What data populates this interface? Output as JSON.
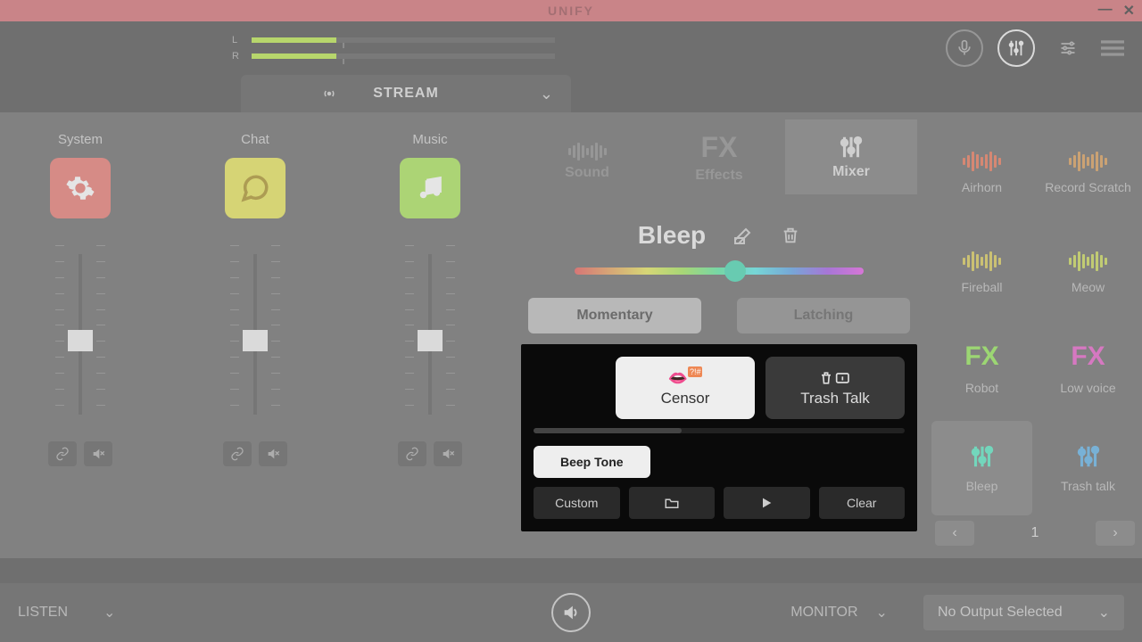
{
  "app": {
    "title": "UNIFY"
  },
  "meters": {
    "left_label": "L",
    "right_label": "R"
  },
  "stream_tab": {
    "label": "STREAM"
  },
  "header_icons": {
    "mic": "mic-icon",
    "mixer": "mixer-icon",
    "settings": "settings-icon"
  },
  "channels": [
    {
      "label": "System",
      "icon": "gear-icon",
      "color": "system"
    },
    {
      "label": "Chat",
      "icon": "chat-icon",
      "color": "chat"
    },
    {
      "label": "Music",
      "icon": "music-icon",
      "color": "music"
    }
  ],
  "tabs": [
    {
      "label": "Sound",
      "icon": "sound-icon"
    },
    {
      "label": "Effects",
      "icon": "fx-icon"
    },
    {
      "label": "Mixer",
      "icon": "mixer-icon"
    }
  ],
  "active_tab": 2,
  "effect": {
    "title": "Bleep",
    "modes": {
      "momentary": "Momentary",
      "latching": "Latching"
    },
    "active_mode": "momentary",
    "presets": [
      {
        "label": "Censor",
        "icon": "censor-icon"
      },
      {
        "label": "Trash Talk",
        "icon": "trash-talk-icon"
      }
    ],
    "active_preset": 0,
    "beep_chip": "Beep Tone",
    "bottom": {
      "custom": "Custom",
      "browse": "folder-icon",
      "play": "play-icon",
      "clear": "Clear"
    }
  },
  "grid": [
    {
      "label": "Airhorn",
      "color": "#e87050"
    },
    {
      "label": "Record Scratch",
      "color": "#d89850"
    },
    {
      "label": "Fireball",
      "color": "#d8c850"
    },
    {
      "label": "Meow",
      "color": "#c8d850"
    },
    {
      "label": "Robot",
      "color": "#90e850",
      "fx": true
    },
    {
      "label": "Low voice",
      "color": "#e858c8",
      "fx": true
    },
    {
      "label": "Bleep",
      "color": "#50e8c0",
      "mixer": true,
      "active": true
    },
    {
      "label": "Trash talk",
      "color": "#58b0e8",
      "mixer": true
    }
  ],
  "pager": {
    "page": "1"
  },
  "footer": {
    "listen": "LISTEN",
    "monitor": "MONITOR",
    "output": "No Output Selected"
  }
}
